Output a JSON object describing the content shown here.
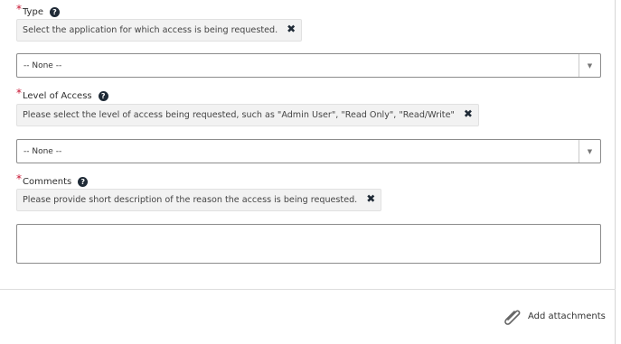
{
  "fields": {
    "type": {
      "label": "Type",
      "hint": "Select the application for which access is being requested.",
      "select_value": "-- None --"
    },
    "level": {
      "label": "Level of Access",
      "hint": "Please select the level of access being requested, such as \"Admin User\", \"Read Only\", \"Read/Write\"",
      "select_value": "-- None --"
    },
    "comments": {
      "label": "Comments",
      "hint": "Please provide short description of the reason the access is being requested.",
      "value": ""
    }
  },
  "required_marker": "*",
  "icons": {
    "help": "question-circle-icon",
    "close": "close-icon",
    "dropdown": "chevron-down-icon",
    "attach": "paperclip-icon"
  },
  "footer": {
    "attach_label": "Add attachments"
  },
  "colors": {
    "required": "#c8102e",
    "icon_dark": "#1f2a36",
    "hint_bg": "#f2f2f2"
  }
}
